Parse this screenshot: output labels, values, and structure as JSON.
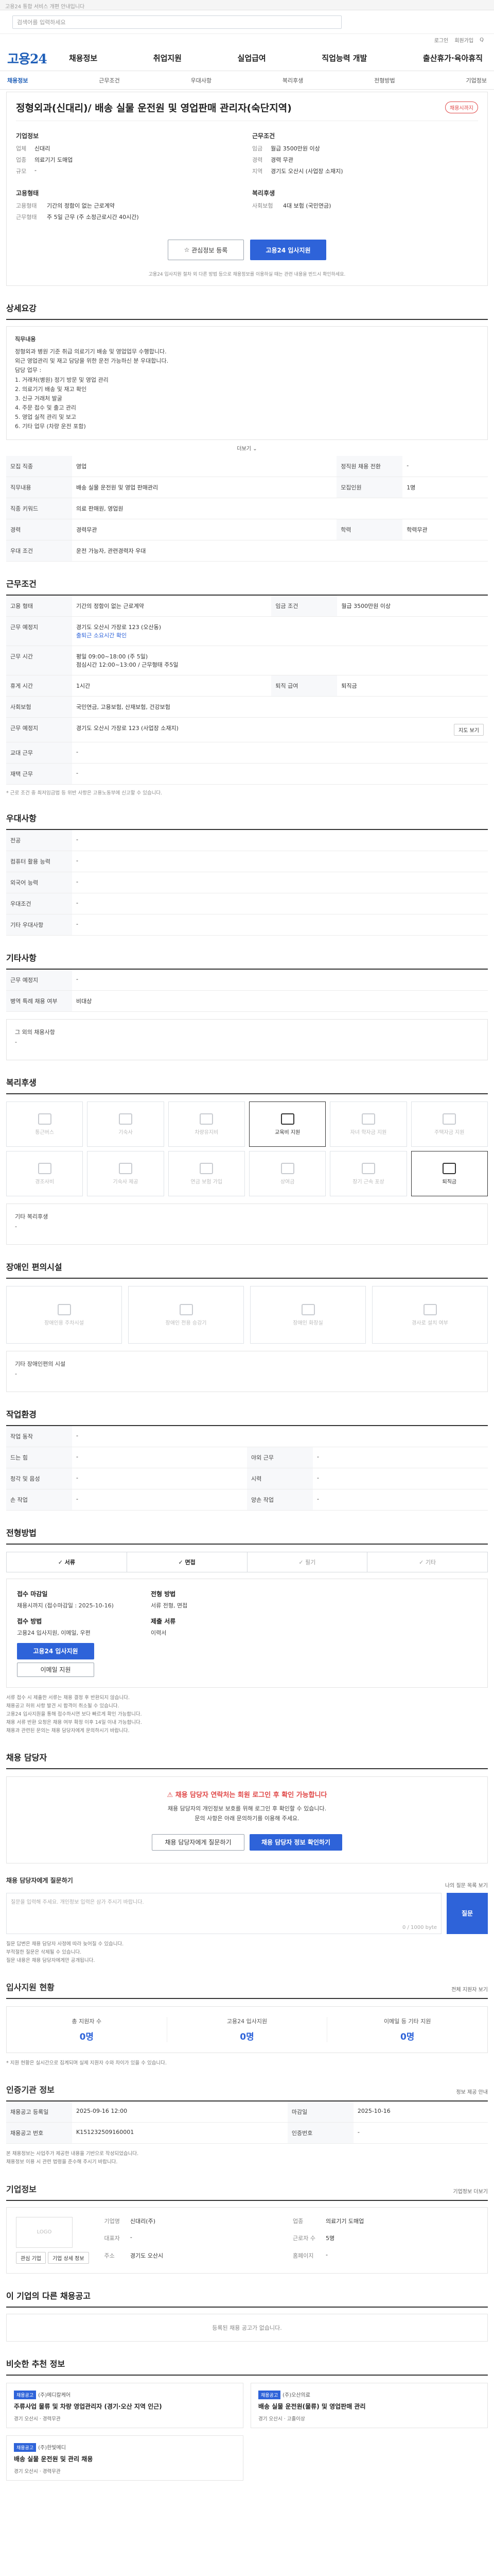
{
  "top": {
    "notice": "고용24 통합 서비스 개편 안내입니다"
  },
  "search": {
    "placeholder": "검색어를 입력하세요"
  },
  "util": {
    "items": [
      "로그인",
      "회원가입",
      "Q"
    ]
  },
  "gnb": {
    "logo": "고용24",
    "menu": [
      "채용정보",
      "취업지원",
      "실업급여",
      "직업능력 개발",
      "출산휴가·육아휴직"
    ]
  },
  "subnav": {
    "items": [
      "채용정보",
      "근무조건",
      "우대사항",
      "복리후생",
      "전형방법",
      "기업정보"
    ],
    "active": 0
  },
  "job": {
    "title": "정형외과(신대리)/ 배송 실물 운전원 및 영업판매 관리자(숙단지역)",
    "badge": "채용시까지"
  },
  "company": {
    "heading": "기업정보",
    "kv": [
      [
        "업체",
        "신대리"
      ],
      [
        "업종",
        "의료기기 도매업"
      ],
      [
        "규모",
        "-"
      ]
    ]
  },
  "conditions": {
    "heading": "근무조건",
    "kv": [
      [
        "임금",
        "월급 3500만원 이상"
      ],
      [
        "경력",
        "경력 무관"
      ],
      [
        "지역",
        "경기도 오산시 (사업장 소재지)"
      ]
    ]
  },
  "employ": {
    "heading": "고용형태",
    "kv": [
      [
        "고용형태",
        "기간의 정함이 없는 근로계약"
      ],
      [
        "근무형태",
        "주 5일 근무 (주 소정근로시간 40시간)"
      ]
    ]
  },
  "welfare": {
    "heading": "복리후생",
    "kv": [
      [
        "사회보험",
        "4대 보험 (국민연금)"
      ]
    ]
  },
  "actions": {
    "scrap": "관심정보 등록",
    "apply": "고용24 입사지원"
  },
  "actionNote": "고용24 입사지원 절차 외 다른 방법 등으로 채용정보를 이용하실 때는 관련 내용을 반드시 확인하세요.",
  "detail": {
    "title": "상세요강",
    "box_heading": "직무내용",
    "lines": [
      "정형외과 병원 기준 취급 의료기기 배송 및 영업업무 수행합니다.",
      "외근 영업관리 및 재고 담당을 위한 운전 가능하신 분 우대합니다.",
      "담당 업무 :",
      "1. 거래처(병원) 정기 방문 및 영업 관리",
      "2. 의료기기 배송 및 재고 확인",
      "3. 신규 거래처 발굴",
      "4. 주문 접수 및 출고 관리",
      "5. 영업 실적 관리 및 보고",
      "6. 기타 업무 (차량 운전 포함)"
    ],
    "more": "더보기"
  },
  "summary": {
    "rows": [
      [
        "모집 직종",
        "영업",
        "정직원 채용 전환",
        "-"
      ],
      [
        "직무내용",
        "배송 실물 운전원 및 영업 판매관리",
        "모집인원",
        "1명"
      ],
      [
        "직종 키워드",
        "의료 판매원, 영업원",
        "",
        ""
      ],
      [
        "경력",
        "경력무관",
        "학력",
        "학력무관"
      ],
      [
        "우대 조건",
        "운전 가능자, 관련경력자 우대",
        "",
        ""
      ]
    ]
  },
  "workcond": {
    "title": "근무조건",
    "rows": [
      [
        "고용 형태",
        "기간의 정함이 없는 근로계약",
        "임금 조건",
        "월급 3500만원 이상"
      ],
      [
        "근무 예정지",
        "경기도 오산시 가장로 123 (오산동)",
        "",
        ""
      ],
      [
        "",
        "",
        "",
        " "
      ]
    ],
    "commute": "출퇴근 소요시간 확인",
    "hours_label": "근무 시간",
    "hours": "평일 09:00~18:00 (주 5일)",
    "break": "점심시간 12:00~13:00 / 근무형태 주5일",
    "shift_label": "휴게 시간",
    "shift": "1시간",
    "insure_label": "사회보험",
    "insure": "국민연금, 고용보험, 산재보험, 건강보험",
    "retire_label": "퇴직 급여",
    "retire": "퇴직금",
    "place_label": "근무 예정지",
    "place": "경기도 오산시 가장로 123 (사업장 소재지)",
    "extra1": "교대 근무",
    "extra2": "재택 근무",
    "note": "* 근로 조건 중 최저임금법 등 위반 사항은 고용노동부에 신고할 수 있습니다.",
    "map_btn": "지도 보기"
  },
  "pref": {
    "title": "우대사항",
    "rows": [
      [
        "전공",
        "-"
      ],
      [
        "컴퓨터 활용 능력",
        "-"
      ],
      [
        "외국어 능력",
        "-"
      ],
      [
        "우대조건",
        "-"
      ],
      [
        "기타 우대사항",
        "-"
      ]
    ]
  },
  "other": {
    "title": "기타사항",
    "rows": [
      [
        "근무 예정지",
        "-"
      ],
      [
        "병역 특례 채용 여부",
        "비대상"
      ]
    ],
    "memo_h": "그 외의 채용사항",
    "memo": "-"
  },
  "benefit": {
    "title": "복리후생",
    "items": [
      "통근버스",
      "기숙사",
      "차량유지비",
      "교육비 지원",
      "자녀 학자금 지원",
      "주택자금 지원",
      "경조사비",
      "기숙사 제공",
      "연금 보험 가입",
      "상여금",
      "장기 근속 포상",
      "퇴직금"
    ],
    "active": [
      3,
      11
    ],
    "etc_h": "기타 복리후생",
    "etc": "-"
  },
  "facility": {
    "title": "장애인 편의시설",
    "items": [
      "장애인용 주차시설",
      "장애인 전용 승강기",
      "장애인 화장실",
      "경사로 설치 여부"
    ],
    "etc_h": "기타 장애인편의 시설",
    "etc": "-"
  },
  "place": {
    "title": "작업환경",
    "rows": [
      [
        "작업 동작",
        "-",
        "",
        ""
      ],
      [
        "드는 힘",
        "-",
        "야외 근무",
        "-"
      ],
      [
        "청각 및 음성",
        "-",
        "시력",
        "-"
      ],
      [
        "손 작업",
        "-",
        "양손 작업",
        "-"
      ]
    ]
  },
  "method": {
    "title": "전형방법",
    "steps": [
      "서류",
      "면접",
      "필기",
      "기타"
    ],
    "active": [
      0,
      1
    ],
    "recv_h": "접수 마감일",
    "recv": "채용시까지 (접수마감일 : 2025-10-16)",
    "howto_h": "접수 방법",
    "howto": "고용24 입사지원, 이메일, 우편",
    "apply_btn": "고용24 입사지원",
    "mail_btn": "이메일 지원",
    "docs_h": "전형 방법",
    "docs": "서류 전형, 면접",
    "result_h": "제출 서류",
    "result": "이력서",
    "bullets": [
      "서류 접수 시 제출한 서류는 채용 결정 후 반환되지 않습니다.",
      "채용공고 허위 사항 발견 시 합격이 취소될 수 있습니다.",
      "고용24 입사지원을 통해 접수하시면 보다 빠르게 확인 가능합니다.",
      "채용 서류 반환 요청은 채용 여부 확정 이후 14일 이내 가능합니다.",
      "채용과 관련된 문의는 채용 담당자에게 문의하시기 바랍니다."
    ]
  },
  "contact": {
    "title": "채용 담당자",
    "alert": "채용 담당자 연락처는 회원 로그인 후 확인 가능합니다",
    "p1": "채용 담당자의 개인정보 보호를 위해 로그인 후 확인할 수 있습니다.",
    "p2": "문의 사항은 아래 문의하기를 이용해 주세요.",
    "btn1": "채용 담당자에게 질문하기",
    "btn2": "채용 담당자 정보 확인하기",
    "ask_h": "채용 담당자에게 질문하기",
    "ask_ph": "질문을 입력해 주세요. 개인정보 입력은 삼가 주시기 바랍니다.",
    "ask_count": "0 / 1000 byte",
    "ask_btn": "질문",
    "ask_side": "나의 질문 목록 보기",
    "notes": [
      "질문 답변은 채용 담당자 사정에 따라 늦어질 수 있습니다.",
      "부적절한 질문은 삭제될 수 있습니다.",
      "질문 내용은 채용 담당자에게만 공개됩니다."
    ]
  },
  "status": {
    "title": "입사지원 현황",
    "side": "전체 지원자 보기",
    "items": [
      [
        "총 지원자 수",
        "0명"
      ],
      [
        "고용24 입사지원",
        "0명"
      ],
      [
        "이메일 등 기타 지원",
        "0명"
      ]
    ],
    "note": "* 지원 현황은 실시간으로 집계되며 실제 지원자 수와 차이가 있을 수 있습니다."
  },
  "info": {
    "title": "인증기관 정보",
    "side": "정보 제공 안내",
    "rows": [
      [
        "채용공고 등록일",
        "2025-09-16 12:00",
        "마감일",
        "2025-10-16"
      ],
      [
        "채용공고 번호",
        "K151232509160001",
        "인증번호",
        "-"
      ]
    ],
    "notes": [
      "본 채용정보는 사업주가 제공한 내용을 기반으로 작성되었습니다.",
      "채용정보 이용 시 관련 법령을 준수해 주시기 바랍니다."
    ]
  },
  "corp": {
    "title": "기업정보",
    "side": "기업정보 더보기",
    "logo": "LOGO",
    "kv": [
      [
        "기업명",
        "신대리(주)",
        "업종",
        "의료기기 도매업"
      ],
      [
        "대표자",
        "-",
        "근로자 수",
        "5명"
      ],
      [
        "주소",
        "경기도 오산시",
        "홈페이지",
        "-"
      ]
    ],
    "b1": "관심 기업",
    "b2": "기업 상세 정보"
  },
  "similar": {
    "title": "이 기업의 다른 채용공고",
    "empty": "등록된 채용 공고가 없습니다."
  },
  "rec": {
    "title": "비슷한 추천 정보",
    "cards": [
      {
        "tag": "채용공고",
        "company": "(주)메디칼케어",
        "title": "주류사업 물류 및 차량 영업관리자 (경기·오산 지역 인근)",
        "meta": "경기 오산시 · 경력무관"
      },
      {
        "tag": "채용공고",
        "company": "(주)오산의료",
        "title": "배송 실물 운전원(물류) 및 영업판매 관리",
        "meta": "경기 오산시 · 고졸이상"
      },
      {
        "tag": "채용공고",
        "company": "(주)한빛메디",
        "title": "배송 실물 운전원 및 관리 채용",
        "meta": "경기 오산시 · 경력무관"
      }
    ]
  }
}
